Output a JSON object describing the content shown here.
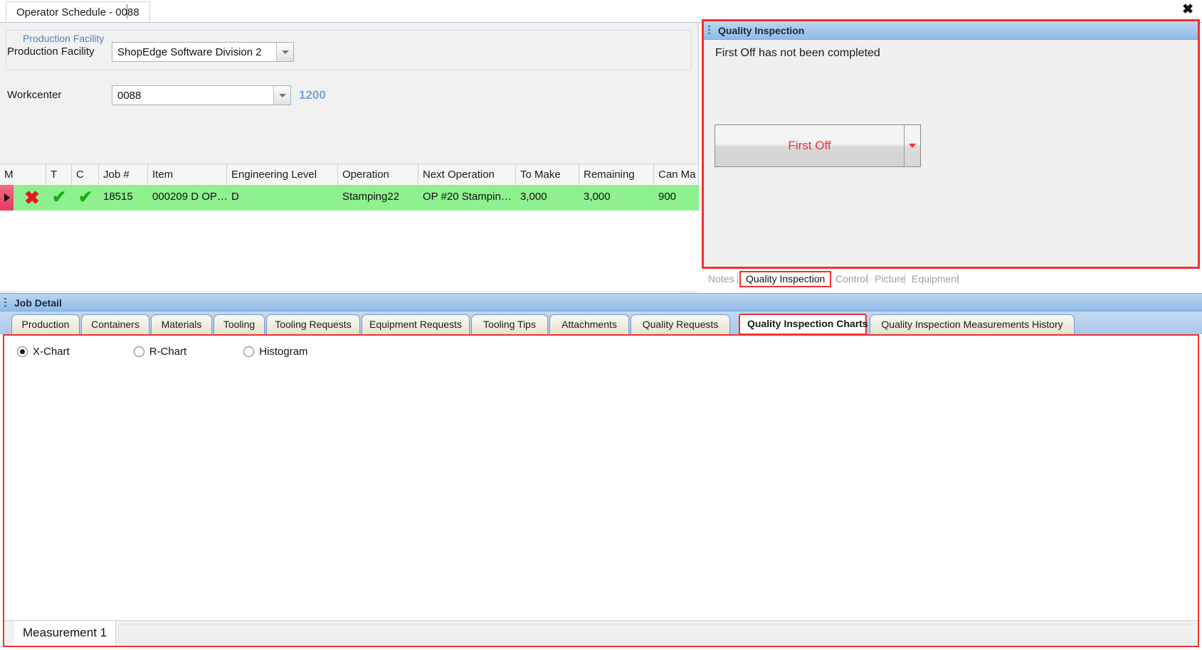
{
  "window": {
    "document_tab": "Operator Schedule - 0088",
    "close_label": "✖"
  },
  "form": {
    "group_title": "Production Facility",
    "facility_label": "Production Facility",
    "facility_value": "ShopEdge Software Division 2",
    "workcenter_label": "Workcenter",
    "workcenter_value": "0088",
    "workcenter_code": "1200"
  },
  "grid": {
    "columns": [
      "M",
      "T",
      "C",
      "Job #",
      "Item",
      "Engineering Level",
      "Operation",
      "Next Operation",
      "To Make",
      "Remaining",
      "Can Ma"
    ],
    "row": {
      "m": "✖",
      "t": "✔",
      "c": "✔",
      "job": "18515",
      "item": "000209  D  OP…",
      "engineering_level": "D",
      "operation": "Stamping22",
      "next_operation": "OP  #20  Stampin…",
      "to_make": "3,000",
      "remaining": "3,000",
      "can_make": "900"
    }
  },
  "scrollbar": {
    "left_arrow": "‹",
    "right_arrow": "›"
  },
  "quality_inspection": {
    "title": "Quality Inspection",
    "message": "First Off has not been completed",
    "first_off_button": "First Off",
    "tabs": [
      {
        "label": "Notes",
        "selected": false
      },
      {
        "label": "Quality Inspection",
        "selected": true
      },
      {
        "label": "Control",
        "selected": false
      },
      {
        "label": "Picture",
        "selected": false
      },
      {
        "label": "Equipment",
        "selected": false
      }
    ]
  },
  "job_detail": {
    "title": "Job Detail",
    "tabs": [
      {
        "label": "Production",
        "selected": false
      },
      {
        "label": "Containers",
        "selected": false
      },
      {
        "label": "Materials",
        "selected": false
      },
      {
        "label": "Tooling",
        "selected": false
      },
      {
        "label": "Tooling Requests",
        "selected": false
      },
      {
        "label": "Equipment Requests",
        "selected": false
      },
      {
        "label": "Tooling Tips",
        "selected": false
      },
      {
        "label": "Attachments",
        "selected": false
      },
      {
        "label": "Quality Requests",
        "selected": false
      },
      {
        "label": "Quality Inspection Charts",
        "selected": true
      },
      {
        "label": "Quality Inspection Measurements History",
        "selected": false
      }
    ],
    "nav": {
      "list_icon": "☰",
      "prev_icon": "◀",
      "next_icon": "▶"
    }
  },
  "chart_panel": {
    "chart_type_options": [
      {
        "label": "X-Chart",
        "selected": true
      },
      {
        "label": "R-Chart",
        "selected": false
      },
      {
        "label": "Histogram",
        "selected": false
      }
    ],
    "measurement_tab": "Measurement 1"
  },
  "colors": {
    "accent_red": "#f03030",
    "row_green": "#8ff08f",
    "title_blue": "#8fbbe8",
    "link_blue": "#5a7fbd"
  }
}
